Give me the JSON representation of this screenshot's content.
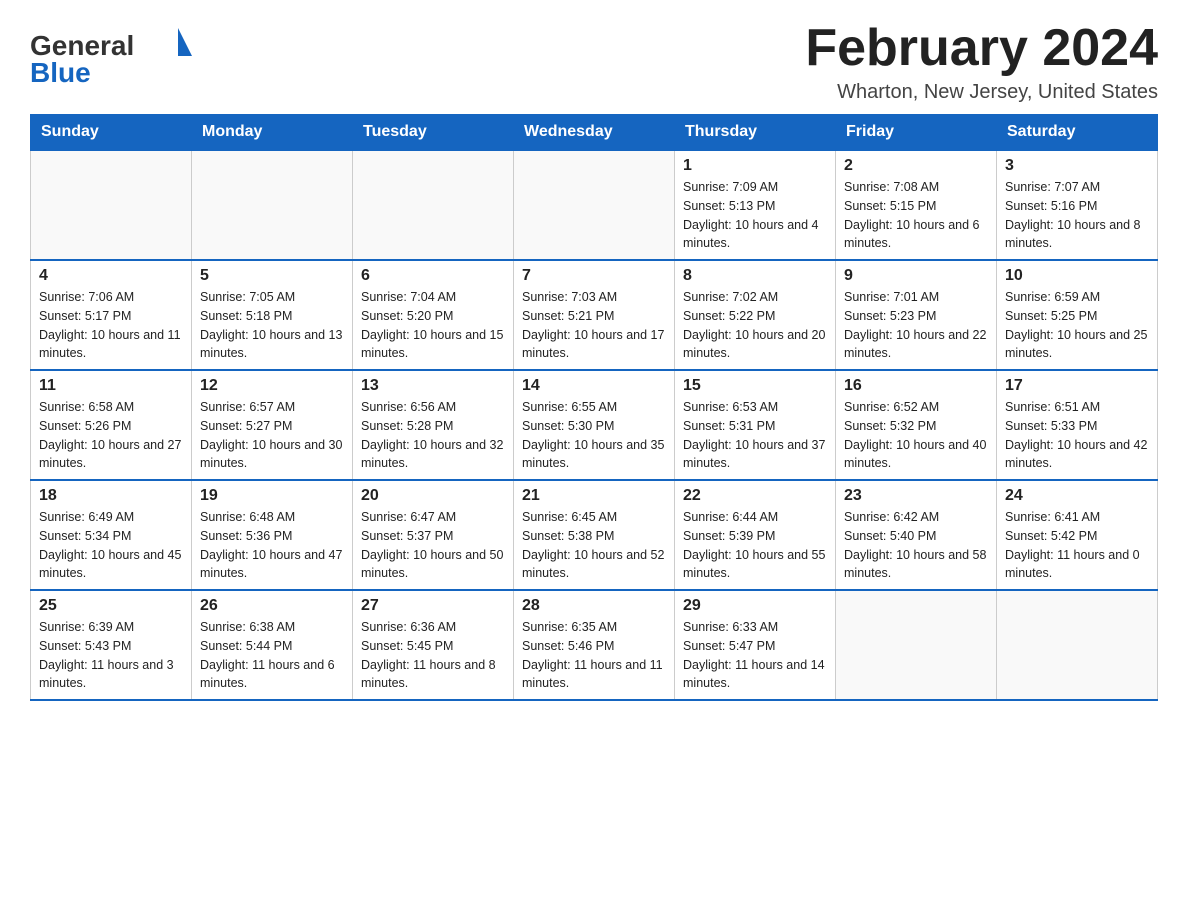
{
  "header": {
    "logo_general": "General",
    "logo_blue": "Blue",
    "title": "February 2024",
    "location": "Wharton, New Jersey, United States"
  },
  "calendar": {
    "days_of_week": [
      "Sunday",
      "Monday",
      "Tuesday",
      "Wednesday",
      "Thursday",
      "Friday",
      "Saturday"
    ],
    "weeks": [
      [
        {
          "day": "",
          "info": ""
        },
        {
          "day": "",
          "info": ""
        },
        {
          "day": "",
          "info": ""
        },
        {
          "day": "",
          "info": ""
        },
        {
          "day": "1",
          "info": "Sunrise: 7:09 AM\nSunset: 5:13 PM\nDaylight: 10 hours and 4 minutes."
        },
        {
          "day": "2",
          "info": "Sunrise: 7:08 AM\nSunset: 5:15 PM\nDaylight: 10 hours and 6 minutes."
        },
        {
          "day": "3",
          "info": "Sunrise: 7:07 AM\nSunset: 5:16 PM\nDaylight: 10 hours and 8 minutes."
        }
      ],
      [
        {
          "day": "4",
          "info": "Sunrise: 7:06 AM\nSunset: 5:17 PM\nDaylight: 10 hours and 11 minutes."
        },
        {
          "day": "5",
          "info": "Sunrise: 7:05 AM\nSunset: 5:18 PM\nDaylight: 10 hours and 13 minutes."
        },
        {
          "day": "6",
          "info": "Sunrise: 7:04 AM\nSunset: 5:20 PM\nDaylight: 10 hours and 15 minutes."
        },
        {
          "day": "7",
          "info": "Sunrise: 7:03 AM\nSunset: 5:21 PM\nDaylight: 10 hours and 17 minutes."
        },
        {
          "day": "8",
          "info": "Sunrise: 7:02 AM\nSunset: 5:22 PM\nDaylight: 10 hours and 20 minutes."
        },
        {
          "day": "9",
          "info": "Sunrise: 7:01 AM\nSunset: 5:23 PM\nDaylight: 10 hours and 22 minutes."
        },
        {
          "day": "10",
          "info": "Sunrise: 6:59 AM\nSunset: 5:25 PM\nDaylight: 10 hours and 25 minutes."
        }
      ],
      [
        {
          "day": "11",
          "info": "Sunrise: 6:58 AM\nSunset: 5:26 PM\nDaylight: 10 hours and 27 minutes."
        },
        {
          "day": "12",
          "info": "Sunrise: 6:57 AM\nSunset: 5:27 PM\nDaylight: 10 hours and 30 minutes."
        },
        {
          "day": "13",
          "info": "Sunrise: 6:56 AM\nSunset: 5:28 PM\nDaylight: 10 hours and 32 minutes."
        },
        {
          "day": "14",
          "info": "Sunrise: 6:55 AM\nSunset: 5:30 PM\nDaylight: 10 hours and 35 minutes."
        },
        {
          "day": "15",
          "info": "Sunrise: 6:53 AM\nSunset: 5:31 PM\nDaylight: 10 hours and 37 minutes."
        },
        {
          "day": "16",
          "info": "Sunrise: 6:52 AM\nSunset: 5:32 PM\nDaylight: 10 hours and 40 minutes."
        },
        {
          "day": "17",
          "info": "Sunrise: 6:51 AM\nSunset: 5:33 PM\nDaylight: 10 hours and 42 minutes."
        }
      ],
      [
        {
          "day": "18",
          "info": "Sunrise: 6:49 AM\nSunset: 5:34 PM\nDaylight: 10 hours and 45 minutes."
        },
        {
          "day": "19",
          "info": "Sunrise: 6:48 AM\nSunset: 5:36 PM\nDaylight: 10 hours and 47 minutes."
        },
        {
          "day": "20",
          "info": "Sunrise: 6:47 AM\nSunset: 5:37 PM\nDaylight: 10 hours and 50 minutes."
        },
        {
          "day": "21",
          "info": "Sunrise: 6:45 AM\nSunset: 5:38 PM\nDaylight: 10 hours and 52 minutes."
        },
        {
          "day": "22",
          "info": "Sunrise: 6:44 AM\nSunset: 5:39 PM\nDaylight: 10 hours and 55 minutes."
        },
        {
          "day": "23",
          "info": "Sunrise: 6:42 AM\nSunset: 5:40 PM\nDaylight: 10 hours and 58 minutes."
        },
        {
          "day": "24",
          "info": "Sunrise: 6:41 AM\nSunset: 5:42 PM\nDaylight: 11 hours and 0 minutes."
        }
      ],
      [
        {
          "day": "25",
          "info": "Sunrise: 6:39 AM\nSunset: 5:43 PM\nDaylight: 11 hours and 3 minutes."
        },
        {
          "day": "26",
          "info": "Sunrise: 6:38 AM\nSunset: 5:44 PM\nDaylight: 11 hours and 6 minutes."
        },
        {
          "day": "27",
          "info": "Sunrise: 6:36 AM\nSunset: 5:45 PM\nDaylight: 11 hours and 8 minutes."
        },
        {
          "day": "28",
          "info": "Sunrise: 6:35 AM\nSunset: 5:46 PM\nDaylight: 11 hours and 11 minutes."
        },
        {
          "day": "29",
          "info": "Sunrise: 6:33 AM\nSunset: 5:47 PM\nDaylight: 11 hours and 14 minutes."
        },
        {
          "day": "",
          "info": ""
        },
        {
          "day": "",
          "info": ""
        }
      ]
    ]
  }
}
